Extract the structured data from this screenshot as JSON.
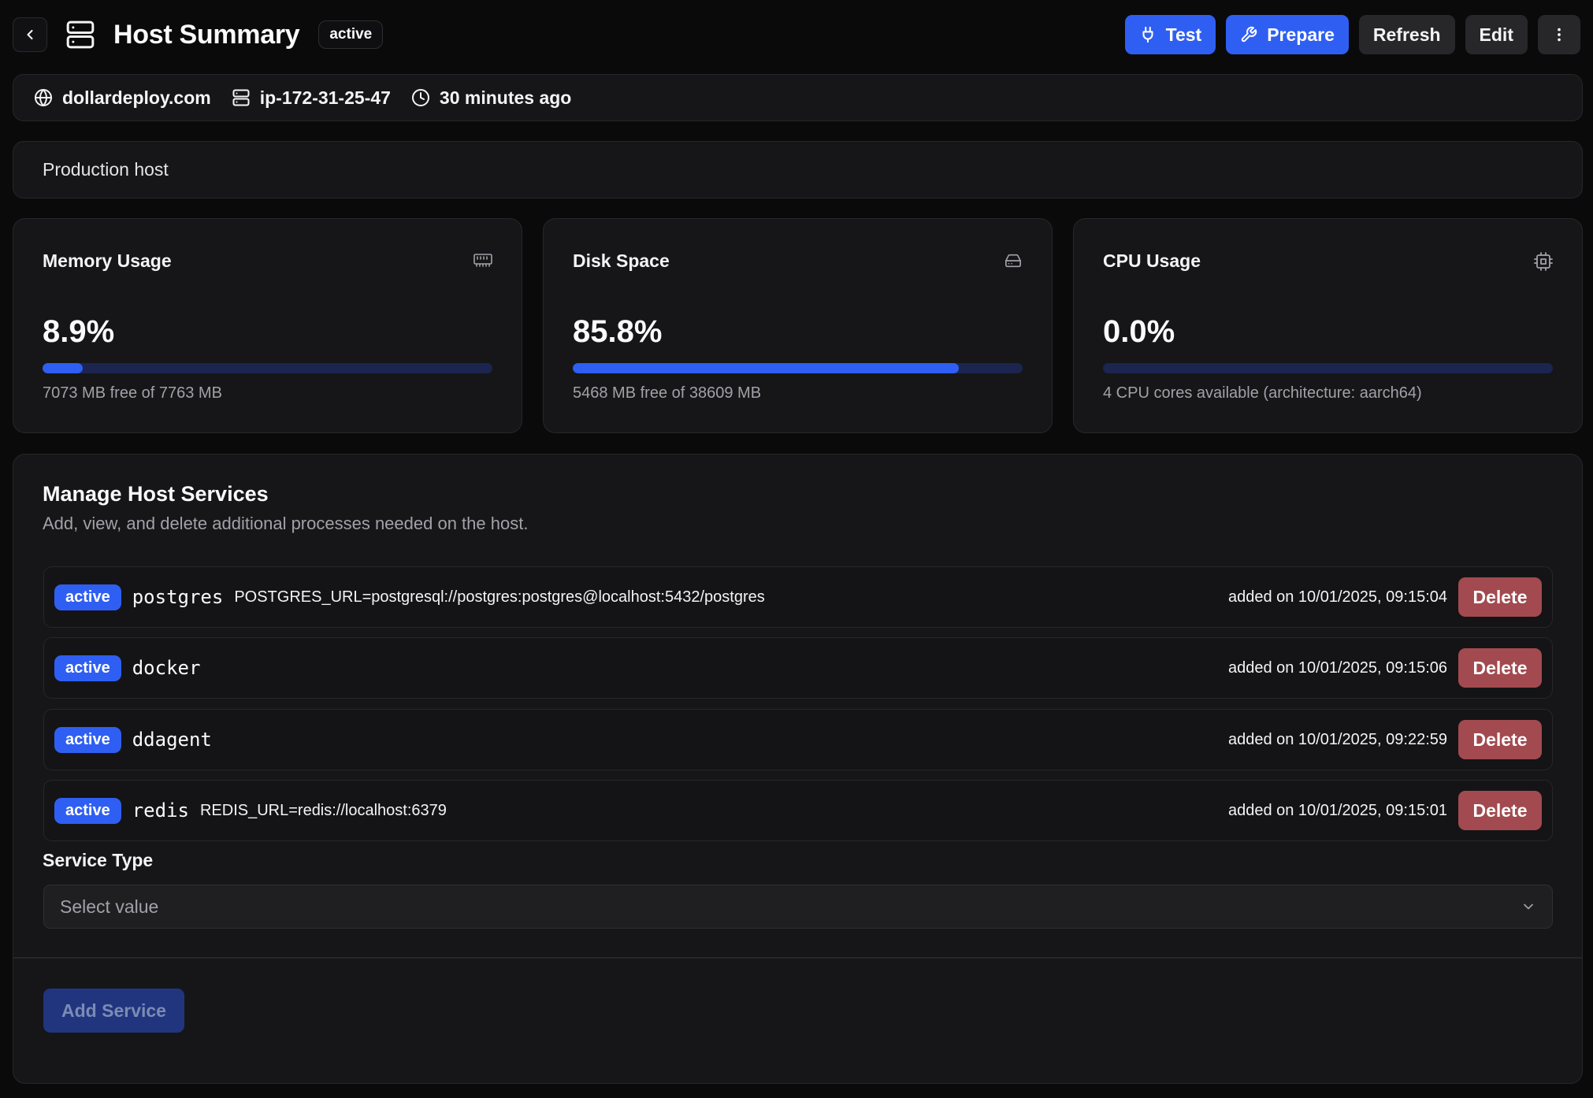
{
  "header": {
    "title": "Host Summary",
    "status": "active",
    "actions": {
      "test": "Test",
      "prepare": "Prepare",
      "refresh": "Refresh",
      "edit": "Edit"
    }
  },
  "info": {
    "domain": "dollardeploy.com",
    "hostname": "ip-172-31-25-47",
    "updated": "30 minutes ago"
  },
  "description": "Production host",
  "stats": {
    "memory": {
      "title": "Memory Usage",
      "value": "8.9%",
      "fraction": 0.089,
      "subtitle": "7073 MB free of 7763 MB"
    },
    "disk": {
      "title": "Disk Space",
      "value": "85.8%",
      "fraction": 0.858,
      "subtitle": "5468 MB free of 38609 MB"
    },
    "cpu": {
      "title": "CPU Usage",
      "value": "0.0%",
      "fraction": 0.0,
      "subtitle": "4 CPU cores available (architecture: aarch64)"
    }
  },
  "services": {
    "title": "Manage Host Services",
    "description": "Add, view, and delete additional processes needed on the host.",
    "items": [
      {
        "status": "active",
        "name": "postgres",
        "env": "POSTGRES_URL=postgresql://postgres:postgres@localhost:5432/postgres",
        "added": "added on 10/01/2025, 09:15:04",
        "delete": "Delete"
      },
      {
        "status": "active",
        "name": "docker",
        "env": "",
        "added": "added on 10/01/2025, 09:15:06",
        "delete": "Delete"
      },
      {
        "status": "active",
        "name": "ddagent",
        "env": "",
        "added": "added on 10/01/2025, 09:22:59",
        "delete": "Delete"
      },
      {
        "status": "active",
        "name": "redis",
        "env": "REDIS_URL=redis://localhost:6379",
        "added": "added on 10/01/2025, 09:15:01",
        "delete": "Delete"
      }
    ],
    "field_label": "Service Type",
    "select_placeholder": "Select value",
    "add_button": "Add Service"
  },
  "colors": {
    "accent": "#2f5ff2",
    "danger": "#a24a4f",
    "background": "#0a0a0b",
    "card": "#161618"
  },
  "icons": [
    "chevron-left-icon",
    "server-icon",
    "plug-icon",
    "wrench-icon",
    "more-vertical-icon",
    "globe-icon",
    "clock-icon",
    "memory-icon",
    "hard-drive-icon",
    "cpu-icon",
    "chevron-down-icon"
  ]
}
